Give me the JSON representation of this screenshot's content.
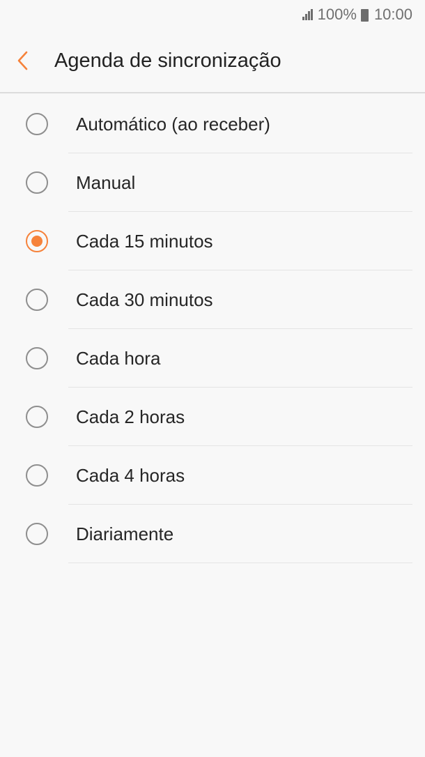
{
  "status_bar": {
    "battery_text": "100%",
    "time": "10:00",
    "icons": [
      "signal-icon",
      "battery-icon"
    ]
  },
  "header": {
    "back_icon": "chevron-left-icon",
    "title": "Agenda de sincronização"
  },
  "accent_color": "#f6823a",
  "options": [
    {
      "label": "Automático (ao receber)",
      "selected": false
    },
    {
      "label": "Manual",
      "selected": false
    },
    {
      "label": "Cada 15 minutos",
      "selected": true
    },
    {
      "label": "Cada 30 minutos",
      "selected": false
    },
    {
      "label": "Cada hora",
      "selected": false
    },
    {
      "label": "Cada 2 horas",
      "selected": false
    },
    {
      "label": "Cada 4 horas",
      "selected": false
    },
    {
      "label": "Diariamente",
      "selected": false
    }
  ]
}
